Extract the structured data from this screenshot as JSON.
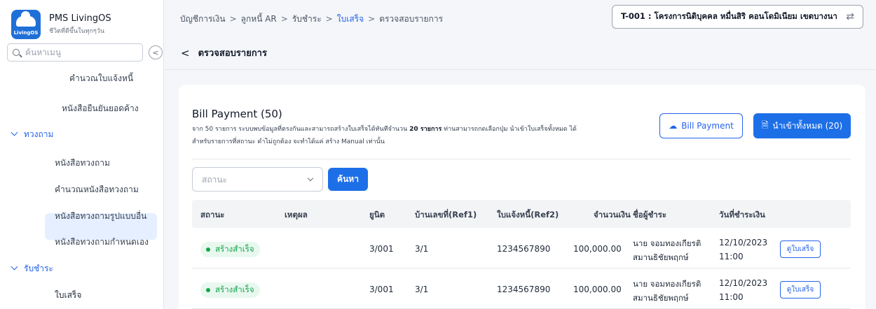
{
  "app": {
    "name": "PMS LivingOS",
    "tagline": "ชีวิตที่ดีขึ้นในทุกๆวัน",
    "logo_text": "LivingOS"
  },
  "sidebar": {
    "search_placeholder": "ค้นหาเมนู",
    "items": [
      {
        "label": "คำนวณใบแจ้งหนี้",
        "type": "item"
      },
      {
        "label": "หนังสือยืนยันยอดค้าง",
        "type": "item"
      },
      {
        "label": "ทวงถาม",
        "type": "group"
      },
      {
        "label": "หนังสือทวงถาม",
        "type": "item"
      },
      {
        "label": "คำนวณหนังสือทวงถาม",
        "type": "item"
      },
      {
        "label": "หนังสือทวงถามรูปแบบอื่น",
        "type": "item"
      },
      {
        "label": "หนังสือทวงถามกำหนดเอง",
        "type": "item"
      },
      {
        "label": "รับชำระ",
        "type": "group"
      },
      {
        "label": "ใบเสร็จ",
        "type": "item",
        "active": true
      }
    ]
  },
  "header": {
    "breadcrumb": [
      "บัญชีการเงิน",
      "ลูกหนี้ AR",
      "รับชำระ",
      "ใบเสร็จ",
      "ตรวจสอบรายการ"
    ],
    "project": "T-001 : โครงการนิติบุคคล หมื่นสิริ คอนโดมิเนียม เขตบางนา",
    "page_title": "ตรวจสอบรายการ"
  },
  "card": {
    "title": "Bill Payment (50)",
    "desc_part1": "จาก 50 รายการ ระบบพบข้อมูลที่ตรงกันและสามารถสร้างใบเสร็จได้ทันทีจำนวน ",
    "desc_bold": "20 รายการ",
    "desc_part2": " ท่านสามารถกดเลือกปุ่ม นำเข้าใบเสร็จทั้งหมด ได้",
    "desc_line2": "สำหรับรายการที่สถานะ คำไม่ถูกต้อง จะทำได้แค่ สร้าง Manual เท่านั้น",
    "btn_bill_payment": "Bill Payment",
    "btn_import_all": "นำเข้าทั้งหมด (20)",
    "status_placeholder": "สถานะ",
    "search_btn": "ค้นหา"
  },
  "table": {
    "headers": [
      "สถานะ",
      "เหตุผล",
      "ยูนิต",
      "บ้านเลขที่(Ref1)",
      "ใบแจ้งหนี้(Ref2)",
      "จำนวนเงิน",
      "ชื่อผู้ชำระ",
      "วันที่ชำระเงิน"
    ],
    "rows": [
      {
        "status": "สร้างสำเร็จ",
        "reason": "",
        "unit": "3/001",
        "house_no": "3/1",
        "invoice": "1234567890",
        "amount": "100,000.00",
        "payer_line1": "นาย จอมทองเกียรติ",
        "payer_line2": "สมานธิชัยพฤกษ์",
        "date": "12/10/2023",
        "time": "11:00",
        "action": "ดูใบเสร็จ"
      },
      {
        "status": "สร้างสำเร็จ",
        "reason": "",
        "unit": "3/001",
        "house_no": "3/1",
        "invoice": "1234567890",
        "amount": "100,000.00",
        "payer_line1": "นาย จอมทองเกียรติ",
        "payer_line2": "สมานธิชัยพฤกษ์",
        "date": "12/10/2023",
        "time": "11:00",
        "action": "ดูใบเสร็จ"
      }
    ]
  },
  "colors": {
    "accent": "#1d6fe8",
    "success": "#16a34a",
    "active_bg": "#e5efff"
  }
}
